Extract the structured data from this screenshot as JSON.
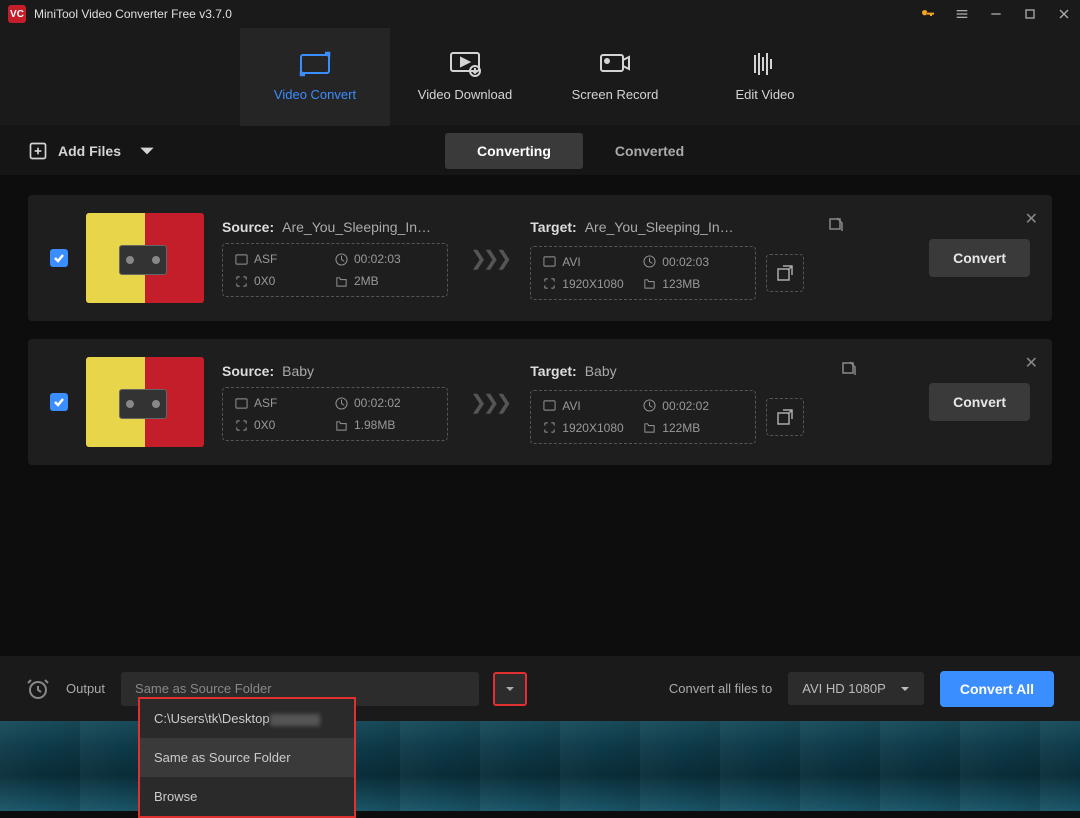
{
  "titlebar": {
    "title": "MiniTool Video Converter Free v3.7.0"
  },
  "mainTabs": {
    "convert": "Video Convert",
    "download": "Video Download",
    "record": "Screen Record",
    "edit": "Edit Video"
  },
  "toolbar": {
    "addFiles": "Add Files"
  },
  "subTabs": {
    "converting": "Converting",
    "converted": "Converted"
  },
  "labels": {
    "source": "Source:",
    "target": "Target:"
  },
  "items": [
    {
      "sourceName": "Are_You_Sleeping_In…",
      "targetName": "Are_You_Sleeping_In…",
      "srcFormat": "ASF",
      "srcDuration": "00:02:03",
      "srcRes": "0X0",
      "srcSize": "2MB",
      "tgtFormat": "AVI",
      "tgtDuration": "00:02:03",
      "tgtRes": "1920X1080",
      "tgtSize": "123MB",
      "button": "Convert"
    },
    {
      "sourceName": "Baby",
      "targetName": "Baby",
      "srcFormat": "ASF",
      "srcDuration": "00:02:02",
      "srcRes": "0X0",
      "srcSize": "1.98MB",
      "tgtFormat": "AVI",
      "tgtDuration": "00:02:02",
      "tgtRes": "1920X1080",
      "tgtSize": "122MB",
      "button": "Convert"
    }
  ],
  "footer": {
    "outputLabel": "Output",
    "outputValue": "Same as Source Folder",
    "convertLabel": "Convert all files to",
    "formatValue": "AVI HD 1080P",
    "convertAll": "Convert All"
  },
  "dropdown": {
    "opt1": "C:\\Users\\tk\\Desktop",
    "opt2": "Same as Source Folder",
    "opt3": "Browse"
  }
}
